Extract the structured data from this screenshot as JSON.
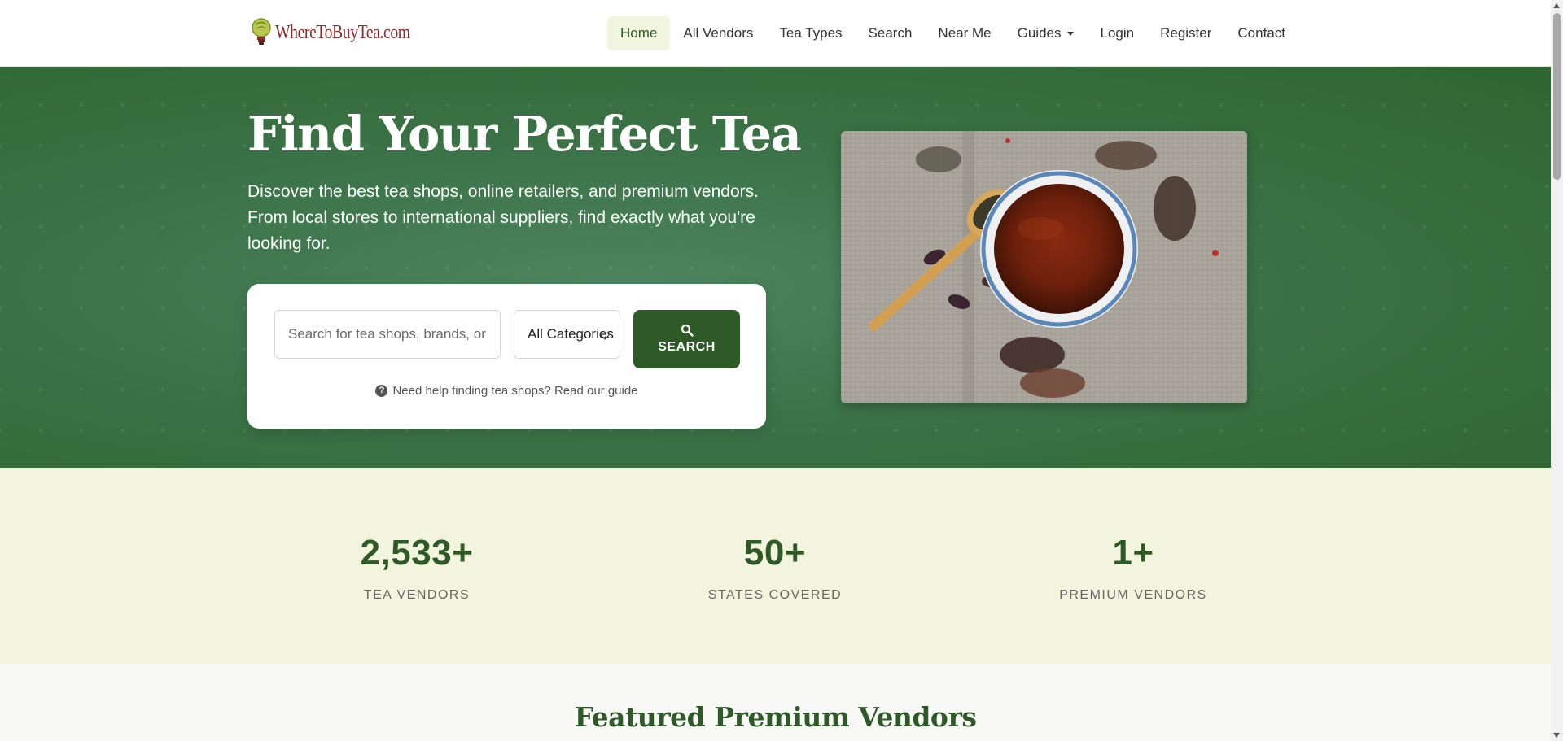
{
  "header": {
    "logo_text": "WhereToBuyTea.com",
    "nav": [
      {
        "label": "Home",
        "active": true
      },
      {
        "label": "All Vendors"
      },
      {
        "label": "Tea Types"
      },
      {
        "label": "Search"
      },
      {
        "label": "Near Me"
      },
      {
        "label": "Guides",
        "has_dropdown": true
      },
      {
        "label": "Login"
      },
      {
        "label": "Register"
      },
      {
        "label": "Contact"
      }
    ]
  },
  "hero": {
    "title": "Find Your Perfect Tea",
    "subtitle": "Discover the best tea shops, online retailers, and premium vendors. From local stores to international suppliers, find exactly what you're looking for.",
    "search": {
      "placeholder": "Search for tea shops, brands, or",
      "category_selected": "All Categories",
      "button_label": "SEARCH",
      "help_text": "Need help finding tea shops? Read our guide"
    }
  },
  "stats": [
    {
      "value": "2,533+",
      "label": "TEA VENDORS"
    },
    {
      "value": "50+",
      "label": "STATES COVERED"
    },
    {
      "value": "1+",
      "label": "PREMIUM VENDORS"
    }
  ],
  "featured": {
    "title": "Featured Premium Vendors"
  },
  "colors": {
    "brand_green": "#2d5a27",
    "hero_green": "#3d7449",
    "stats_bg": "#f3f4dd",
    "logo_red": "#8a2d2d"
  }
}
